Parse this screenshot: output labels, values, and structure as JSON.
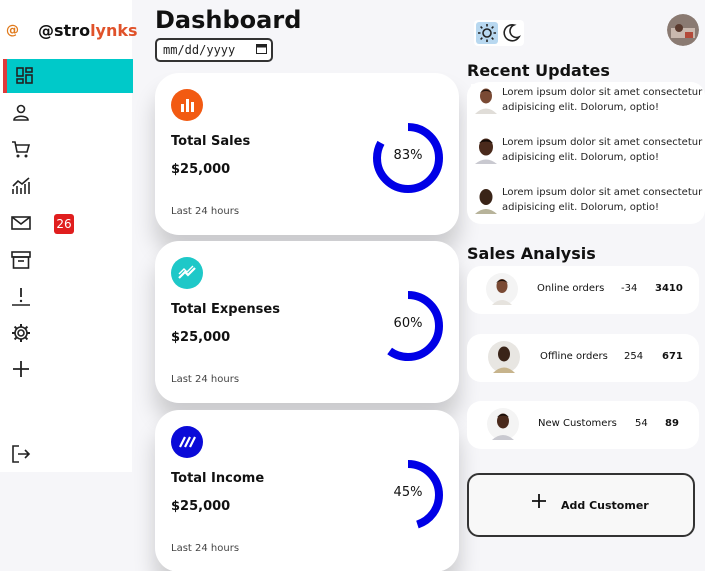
{
  "brand": {
    "mark": "@",
    "name_prefix": "@stro",
    "name_suffix": "lynks"
  },
  "sidebar": {
    "items": [
      {
        "icon": "dashboard-icon",
        "active": true
      },
      {
        "icon": "person-icon"
      },
      {
        "icon": "cart-icon"
      },
      {
        "icon": "analytics-icon"
      },
      {
        "icon": "mail-icon",
        "badge": "26"
      },
      {
        "icon": "archive-icon"
      },
      {
        "icon": "report-icon"
      },
      {
        "icon": "settings-icon"
      },
      {
        "icon": "add-icon"
      },
      {
        "icon": "logout-icon"
      }
    ]
  },
  "header": {
    "title": "Dashboard",
    "date_placeholder": "mm/dd/yyyy"
  },
  "cards": [
    {
      "title": "Total Sales",
      "value": "$25,000",
      "footer": "Last 24 hours",
      "percent_label": "83%",
      "percent": 83,
      "icon": "bar-chart-icon",
      "color": "#f25a12"
    },
    {
      "title": "Total Expenses",
      "value": "$25,000",
      "footer": "Last 24 hours",
      "percent_label": "60%",
      "percent": 60,
      "icon": "trending-icon",
      "color": "#1ec8c8"
    },
    {
      "title": "Total Income",
      "value": "$25,000",
      "footer": "Last 24 hours",
      "percent_label": "45%",
      "percent": 45,
      "icon": "stripes-icon",
      "color": "#0a0ad8"
    }
  ],
  "ring_color": "#0000e6",
  "recent_updates": {
    "title": "Recent Updates",
    "items": [
      {
        "text": "Lorem ipsum dolor sit amet consectetur adipisicing elit. Dolorum, optio!"
      },
      {
        "text": "Lorem ipsum dolor sit amet consectetur adipisicing elit. Dolorum, optio!"
      },
      {
        "text": "Lorem ipsum dolor sit amet consectetur adipisicing elit. Dolorum, optio!"
      }
    ]
  },
  "sales_analysis": {
    "title": "Sales Analysis",
    "rows": [
      {
        "name": "Online orders",
        "delta": "-34",
        "total": "3410"
      },
      {
        "name": "Offline orders",
        "delta": "254",
        "total": "671"
      },
      {
        "name": "New Customers",
        "delta": "54",
        "total": "89"
      }
    ]
  },
  "add_customer": {
    "label": "Add Customer"
  }
}
